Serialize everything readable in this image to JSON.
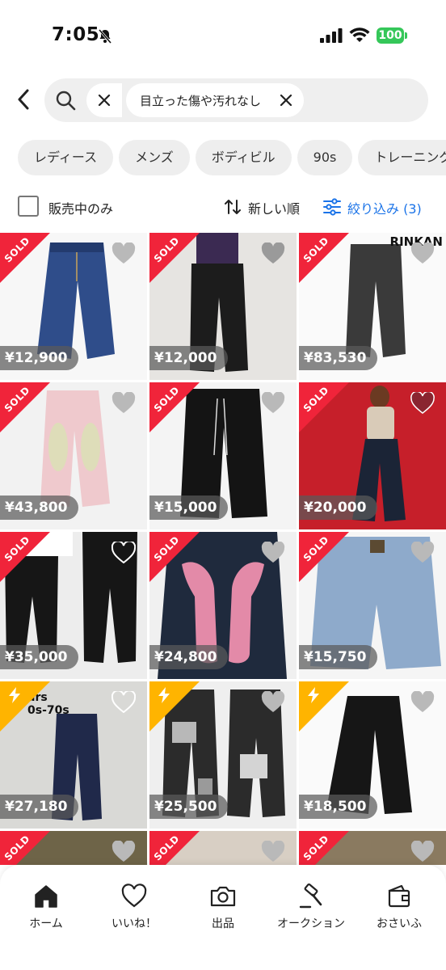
{
  "status_bar": {
    "time": "7:05",
    "battery": "100"
  },
  "search": {
    "query": "目立った傷や汚れなし"
  },
  "categories": [
    "レディース",
    "メンズ",
    "ボディビル",
    "90s",
    "トレーニング"
  ],
  "filters": {
    "checkbox_label": "販売中のみ",
    "sort_label": "新しい順",
    "filter_label": "絞り込み (3)"
  },
  "items": [
    {
      "price": "¥12,900",
      "badge": "SOLD"
    },
    {
      "price": "¥12,000",
      "badge": "SOLD"
    },
    {
      "price": "¥83,530",
      "badge": "SOLD",
      "overlay": "RINKAN"
    },
    {
      "price": "¥43,800",
      "badge": "SOLD"
    },
    {
      "price": "¥15,000",
      "badge": "SOLD"
    },
    {
      "price": "¥20,000",
      "badge": "SOLD"
    },
    {
      "price": "¥35,000",
      "badge": "SOLD"
    },
    {
      "price": "¥24,800",
      "badge": "SOLD"
    },
    {
      "price": "¥15,750",
      "badge": "SOLD"
    },
    {
      "price": "¥27,180",
      "badge": "flash",
      "overlay": "ars\n0s-70s"
    },
    {
      "price": "¥25,500",
      "badge": "flash"
    },
    {
      "price": "¥18,500",
      "badge": "flash"
    },
    {
      "price": "",
      "badge": "SOLD"
    },
    {
      "price": "",
      "badge": "SOLD"
    },
    {
      "price": "",
      "badge": "SOLD"
    }
  ],
  "bottom_nav": [
    {
      "label": "ホーム",
      "icon": "home-icon"
    },
    {
      "label": "いいね！",
      "icon": "heart-icon"
    },
    {
      "label": "出品",
      "icon": "camera-icon"
    },
    {
      "label": "オークション",
      "icon": "gavel-icon"
    },
    {
      "label": "おさいふ",
      "icon": "wallet-icon"
    }
  ],
  "colors": {
    "sold": "#f0243a",
    "flash": "#ffb400",
    "link": "#1a73e8",
    "battery": "#35c759"
  }
}
